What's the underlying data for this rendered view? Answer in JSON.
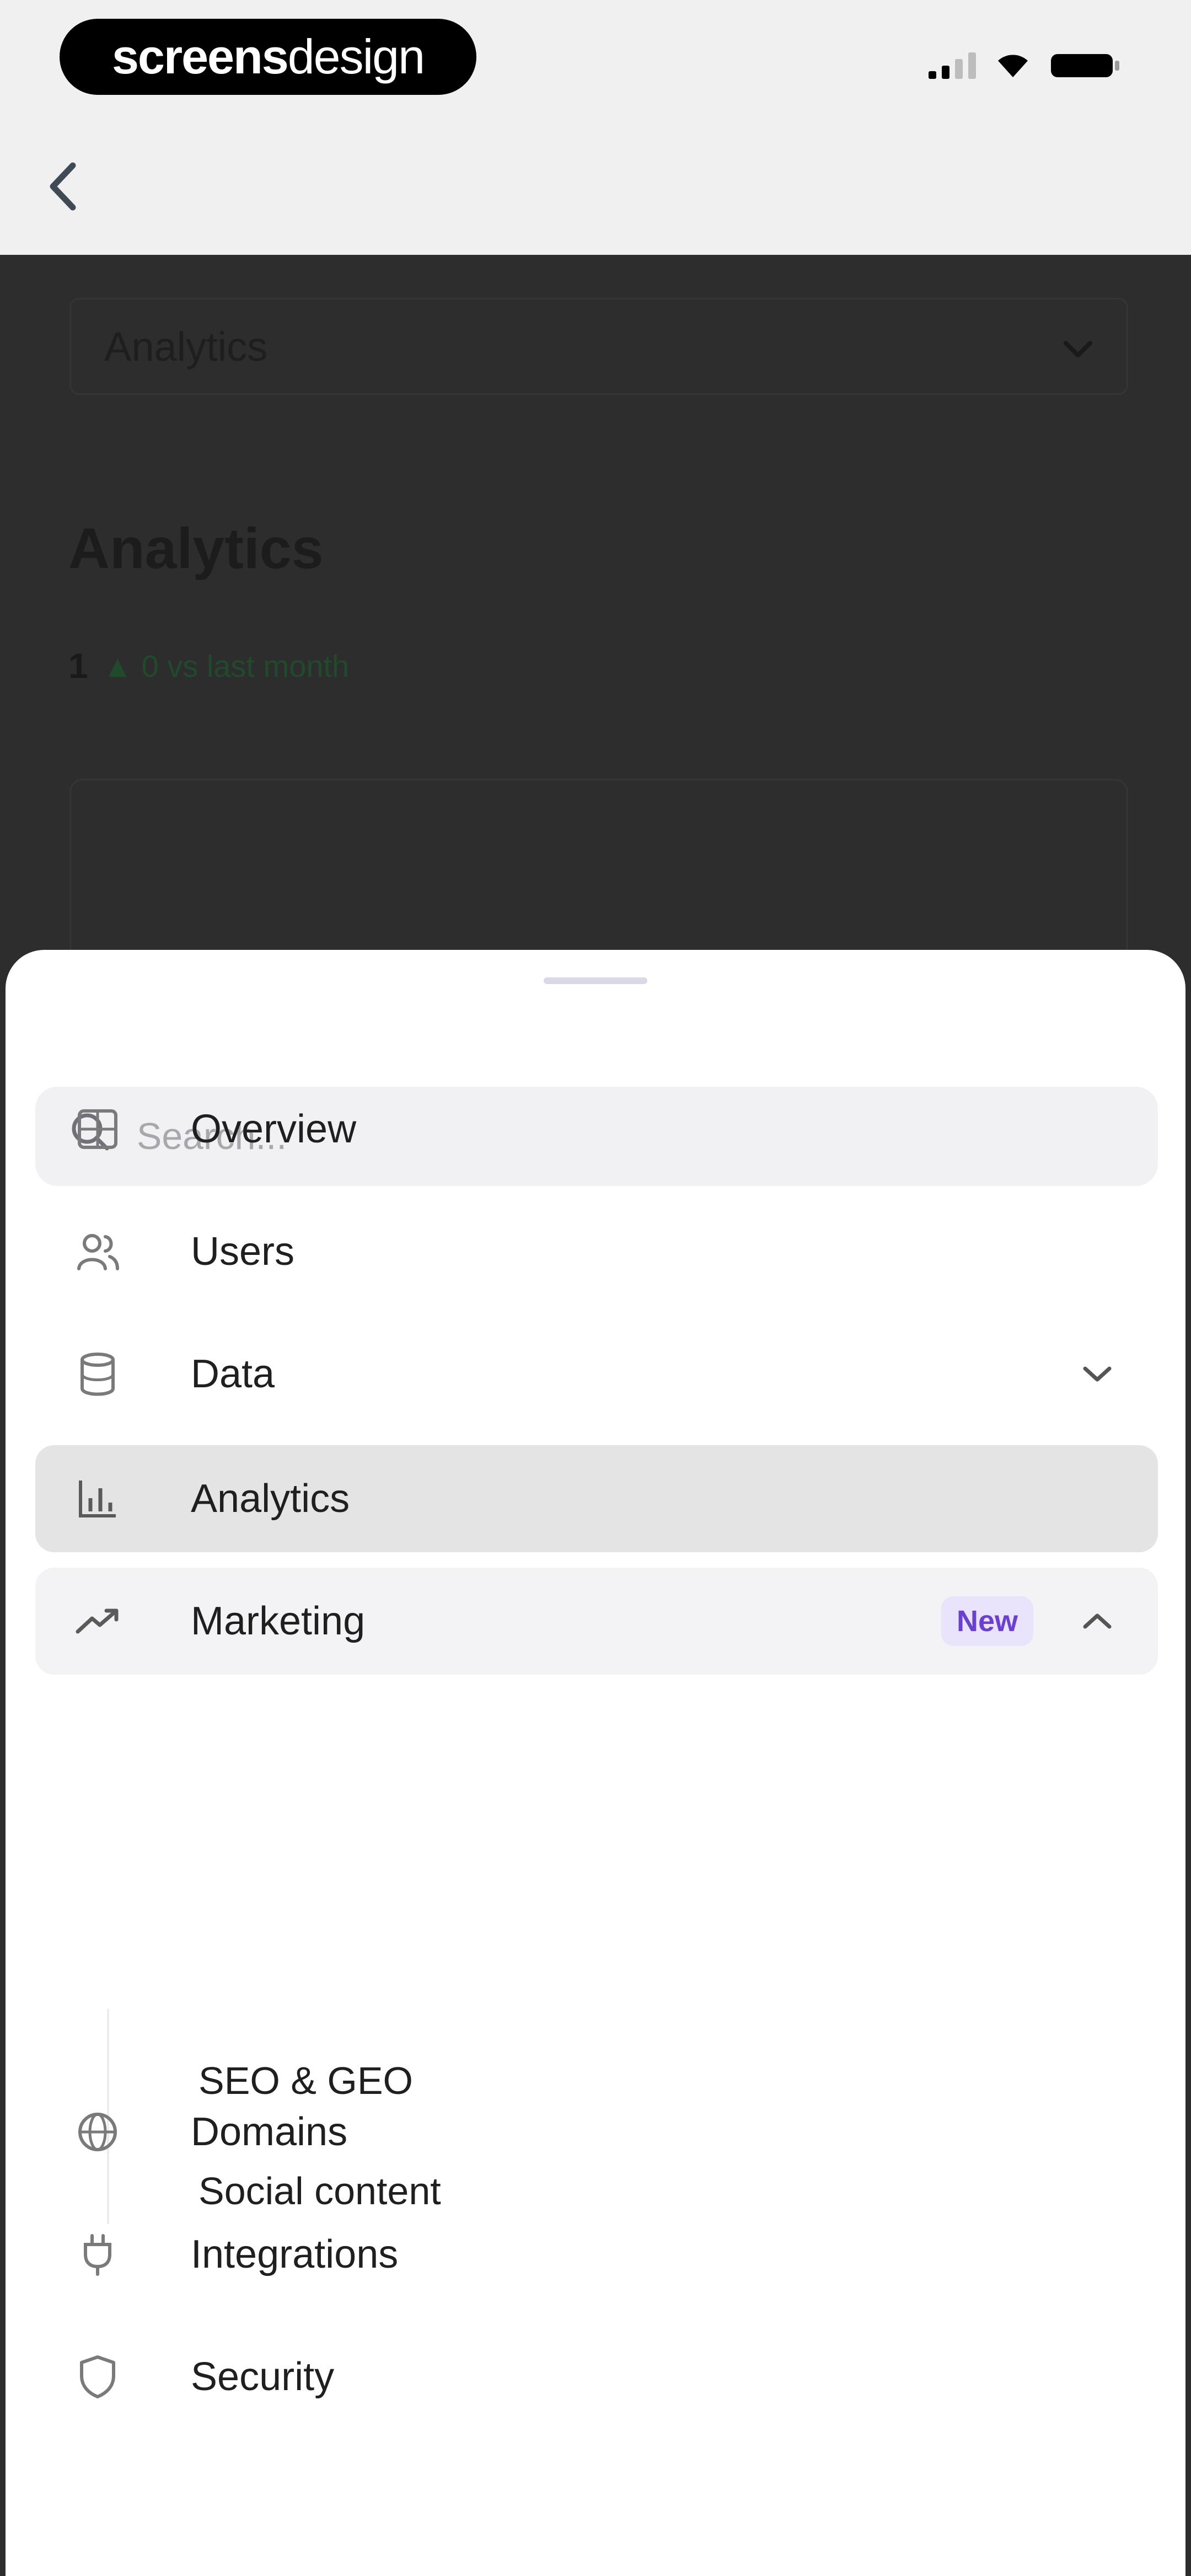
{
  "brand": {
    "bold": "screens",
    "thin": "design"
  },
  "page": {
    "select_value": "Analytics",
    "title": "Analytics",
    "metric_value": "1",
    "metric_delta": "▲ 0 vs last month"
  },
  "sheet": {
    "search_placeholder": "Search...",
    "items": [
      {
        "label": "Overview",
        "icon": "grid-icon"
      },
      {
        "label": "Users",
        "icon": "users-icon"
      },
      {
        "label": "Data",
        "icon": "database-icon"
      },
      {
        "label": "Analytics",
        "icon": "bar-chart-icon",
        "state": "active"
      },
      {
        "label": "Marketing",
        "icon": "trend-icon",
        "badge": "New",
        "state": "expanded"
      },
      {
        "label": "Domains",
        "icon": "globe-icon"
      },
      {
        "label": "Integrations",
        "icon": "plug-icon"
      },
      {
        "label": "Security",
        "icon": "shield-icon"
      }
    ],
    "marketing_children": [
      "SEO & GEO",
      "Social content"
    ]
  },
  "colors": {
    "overlay": "#2d2d2d",
    "active_bg": "#e4e4e4",
    "expanded_bg": "#f3f3f5",
    "badge_bg": "#e9e3fb",
    "badge_text": "#6b3fd4",
    "positive": "#1f4a2c"
  }
}
